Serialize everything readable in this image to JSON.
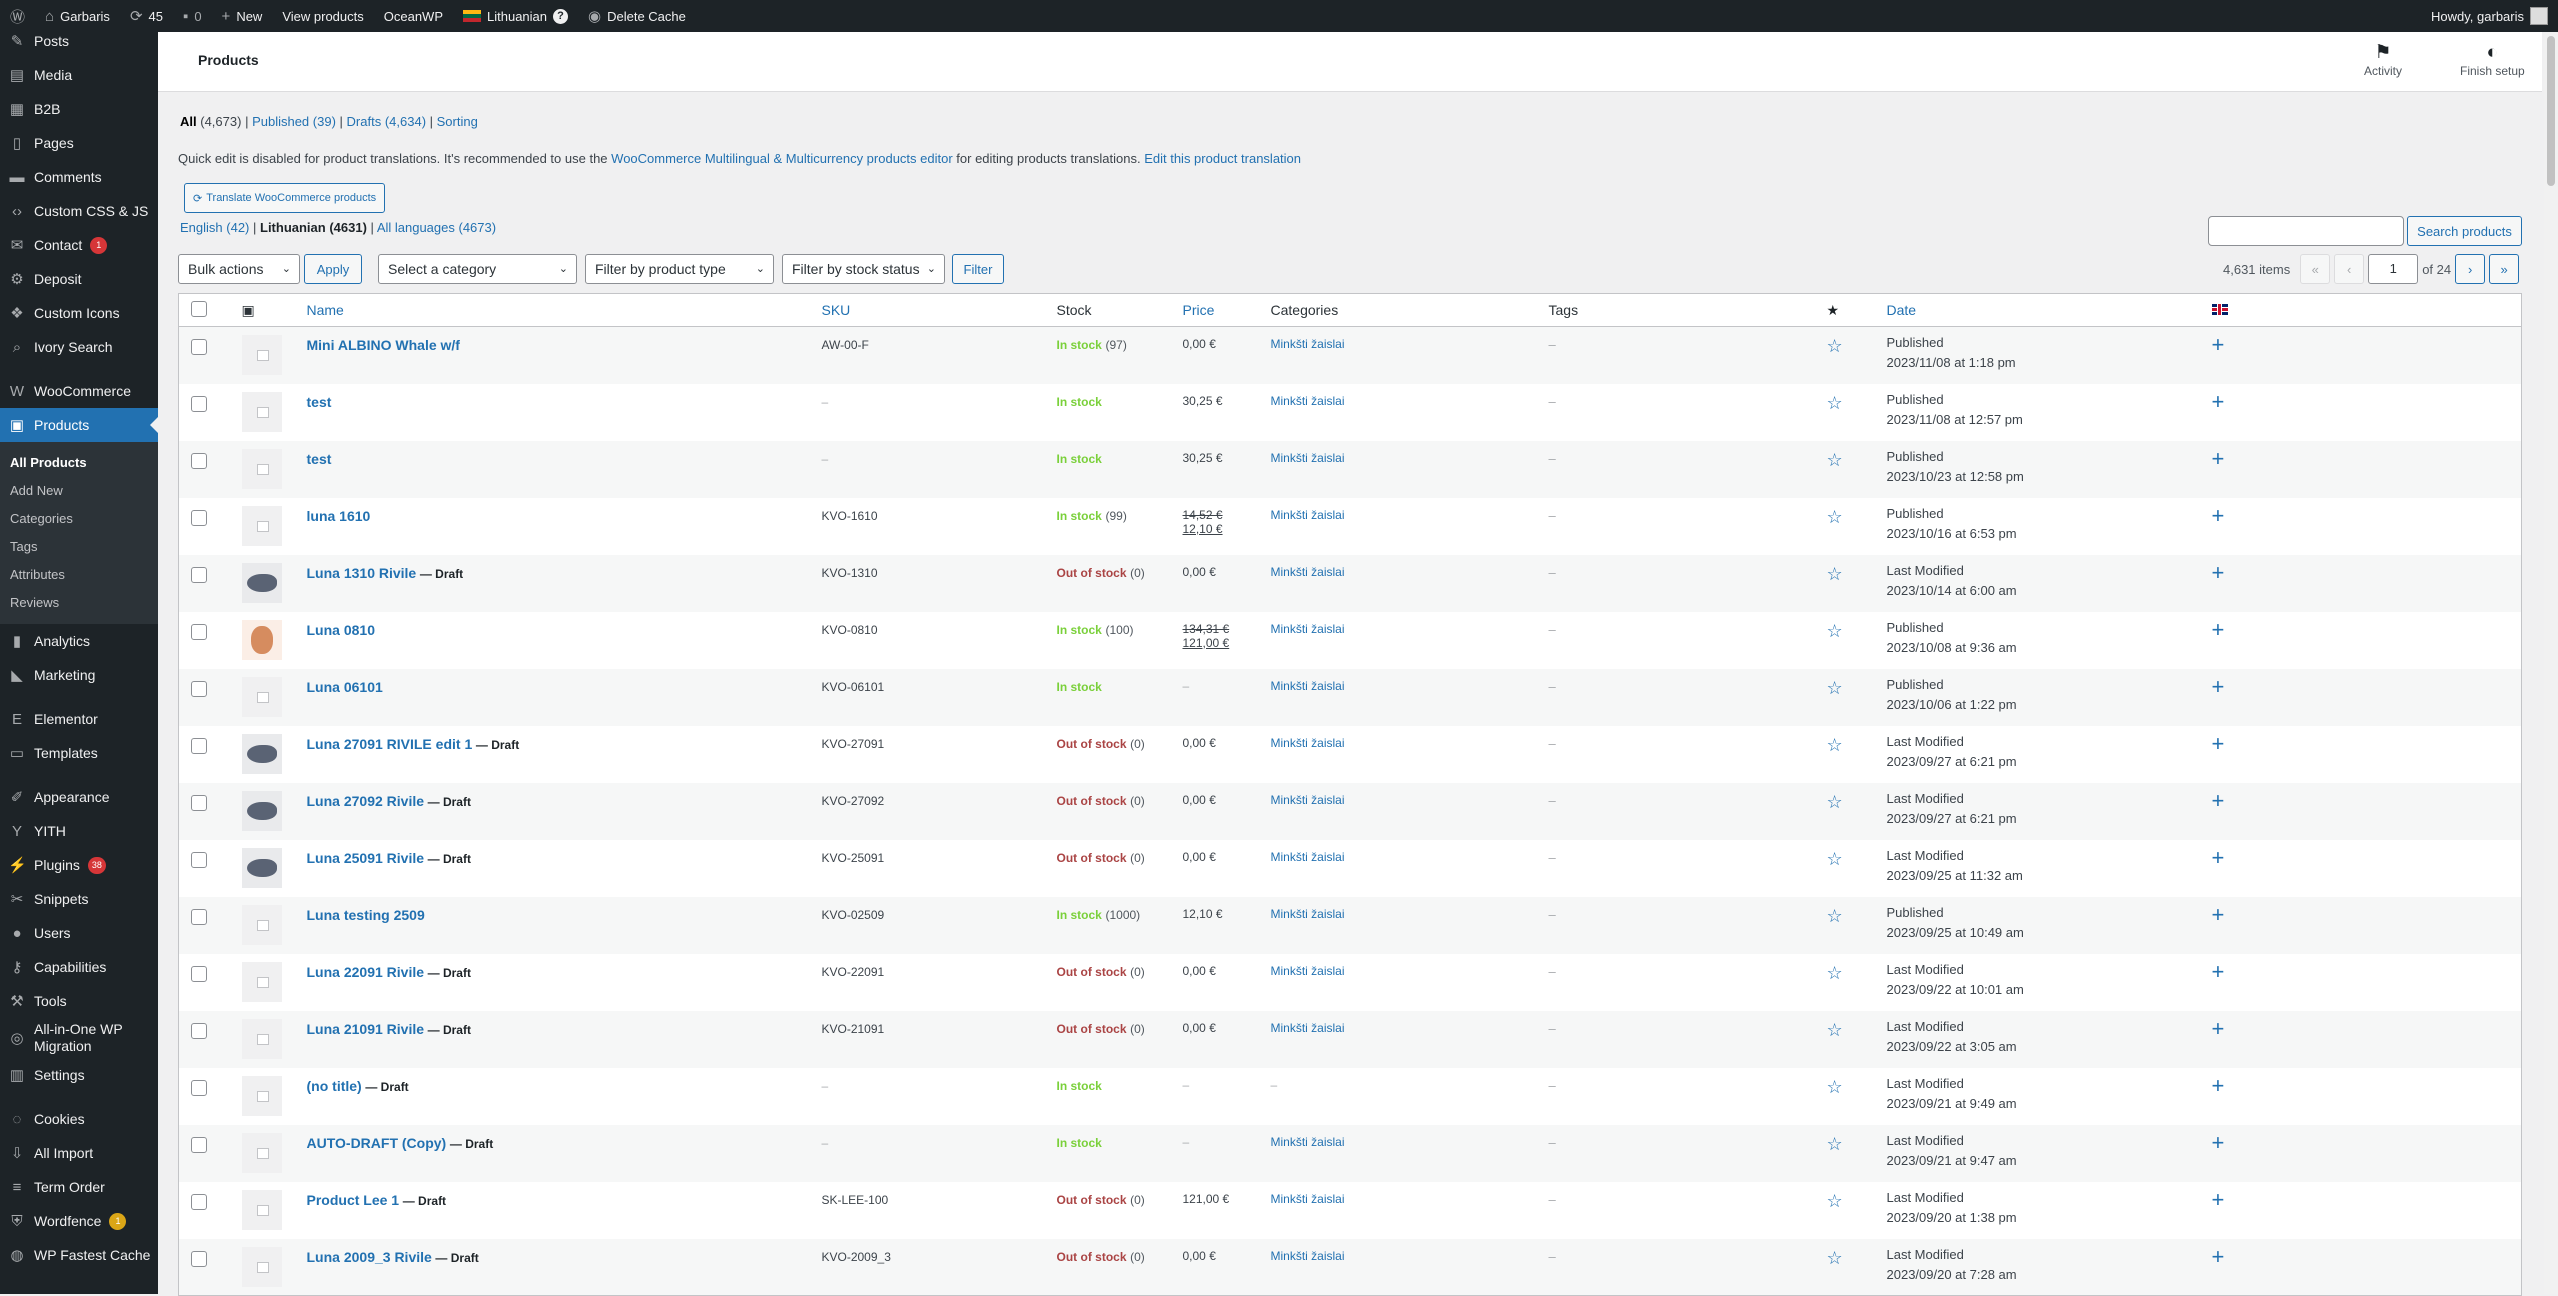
{
  "adminbar": {
    "site_name": "Garbaris",
    "updates": "45",
    "comments": "0",
    "new_label": "New",
    "view_products": "View products",
    "theme": "OceanWP",
    "language": "Lithuanian",
    "language_help": "?",
    "delete_cache": "Delete Cache",
    "howdy": "Howdy, garbaris"
  },
  "sidebar": {
    "items": [
      {
        "label": "Posts",
        "icon": "pin-icon"
      },
      {
        "label": "Media",
        "icon": "media-icon"
      },
      {
        "label": "B2B",
        "icon": "b2b-icon"
      },
      {
        "label": "Pages",
        "icon": "page-icon"
      },
      {
        "label": "Comments",
        "icon": "comment-icon"
      },
      {
        "label": "Custom CSS & JS",
        "icon": "code-icon"
      },
      {
        "label": "Contact",
        "icon": "mail-icon",
        "badge": "1"
      },
      {
        "label": "Deposit",
        "icon": "gear-icon"
      },
      {
        "label": "Custom Icons",
        "icon": "icons-icon"
      },
      {
        "label": "Ivory Search",
        "icon": "search-icon"
      },
      {
        "label": "WooCommerce",
        "icon": "woo-icon"
      },
      {
        "label": "Products",
        "icon": "box-icon"
      },
      {
        "label": "Analytics",
        "icon": "chart-icon"
      },
      {
        "label": "Marketing",
        "icon": "megaphone-icon"
      },
      {
        "label": "Elementor",
        "icon": "elementor-icon"
      },
      {
        "label": "Templates",
        "icon": "folder-icon"
      },
      {
        "label": "Appearance",
        "icon": "brush-icon"
      },
      {
        "label": "YITH",
        "icon": "yith-icon"
      },
      {
        "label": "Plugins",
        "icon": "plug-icon",
        "badge": "38"
      },
      {
        "label": "Snippets",
        "icon": "scissors-icon"
      },
      {
        "label": "Users",
        "icon": "user-icon"
      },
      {
        "label": "Capabilities",
        "icon": "key-icon"
      },
      {
        "label": "Tools",
        "icon": "wrench-icon"
      },
      {
        "label": "All-in-One WP Migration",
        "icon": "migration-icon"
      },
      {
        "label": "Settings",
        "icon": "settings-icon"
      },
      {
        "label": "Cookies",
        "icon": "cookie-icon"
      },
      {
        "label": "All Import",
        "icon": "import-icon"
      },
      {
        "label": "Term Order",
        "icon": "list-icon"
      },
      {
        "label": "Wordfence",
        "icon": "shield-icon",
        "badge": "1"
      },
      {
        "label": "WP Fastest Cache",
        "icon": "cache-icon"
      }
    ],
    "products_sub": [
      "All Products",
      "Add New",
      "Categories",
      "Tags",
      "Attributes",
      "Reviews"
    ]
  },
  "header": {
    "title": "Products",
    "activity": "Activity",
    "finish_setup": "Finish setup"
  },
  "views": {
    "all": "All",
    "all_count": "(4,673)",
    "published": "Published",
    "published_count": "(39)",
    "drafts": "Drafts",
    "drafts_count": "(4,634)",
    "sorting": "Sorting"
  },
  "notice": {
    "text1": "Quick edit is disabled for product translations. It's recommended to use the",
    "link1": "WooCommerce Multilingual & Multicurrency products editor",
    "text2": "for editing products translations.",
    "link2": "Edit this product translation"
  },
  "translate_button": "Translate WooCommerce products",
  "languages": {
    "english": "English",
    "english_count": "(42)",
    "lithuanian": "Lithuanian",
    "lithuanian_count": "(4631)",
    "all": "All languages",
    "all_count": "(4673)"
  },
  "search": {
    "button": "Search products",
    "value": ""
  },
  "filters": {
    "bulk_actions": "Bulk actions",
    "apply": "Apply",
    "category": "Select a category",
    "product_type": "Filter by product type",
    "stock_status": "Filter by stock status",
    "filter": "Filter"
  },
  "pagination": {
    "items": "4,631 items",
    "first": "«",
    "prev": "‹",
    "current": "1",
    "of": "of 24",
    "next": "›",
    "last": "»"
  },
  "columns": {
    "name": "Name",
    "sku": "SKU",
    "stock": "Stock",
    "price": "Price",
    "categories": "Categories",
    "tags": "Tags",
    "featured": "★",
    "date": "Date"
  },
  "rows": [
    {
      "name": "Mini ALBINO Whale w/f",
      "draft": "",
      "sku": "AW-00-F",
      "stock": "In stock",
      "stock_count": "(97)",
      "price": "0,00 €",
      "price_old": "",
      "category": "Minkšti žaislai",
      "tags": "–",
      "date_status": "Published",
      "date": "2023/11/08 at 1:18 pm",
      "thumb": "placeholder"
    },
    {
      "name": "test",
      "draft": "",
      "sku": "–",
      "stock": "In stock",
      "stock_count": "",
      "price": "30,25 €",
      "price_old": "",
      "category": "Minkšti žaislai",
      "tags": "–",
      "date_status": "Published",
      "date": "2023/11/08 at 12:57 pm",
      "thumb": "placeholder"
    },
    {
      "name": "test",
      "draft": "",
      "sku": "–",
      "stock": "In stock",
      "stock_count": "",
      "price": "30,25 €",
      "price_old": "",
      "category": "Minkšti žaislai",
      "tags": "–",
      "date_status": "Published",
      "date": "2023/10/23 at 12:58 pm",
      "thumb": "placeholder"
    },
    {
      "name": "luna 1610",
      "draft": "",
      "sku": "KVO-1610",
      "stock": "In stock",
      "stock_count": "(99)",
      "price": "12,10 €",
      "price_old": "14,52 €",
      "category": "Minkšti žaislai",
      "tags": "–",
      "date_status": "Published",
      "date": "2023/10/16 at 6:53 pm",
      "thumb": "placeholder"
    },
    {
      "name": "Luna 1310 Rivile",
      "draft": "— Draft",
      "sku": "KVO-1310",
      "stock": "Out of stock",
      "stock_count": "(0)",
      "price": "0,00 €",
      "price_old": "",
      "category": "Minkšti žaislai",
      "tags": "–",
      "date_status": "Last Modified",
      "date": "2023/10/14 at 6:00 am",
      "thumb": "shark"
    },
    {
      "name": "Luna 0810",
      "draft": "",
      "sku": "KVO-0810",
      "stock": "In stock",
      "stock_count": "(100)",
      "price": "121,00 €",
      "price_old": "134,31 €",
      "category": "Minkšti žaislai",
      "tags": "–",
      "date_status": "Published",
      "date": "2023/10/08 at 9:36 am",
      "thumb": "bear"
    },
    {
      "name": "Luna 06101",
      "draft": "",
      "sku": "KVO-06101",
      "stock": "In stock",
      "stock_count": "",
      "price": "–",
      "price_old": "",
      "category": "Minkšti žaislai",
      "tags": "–",
      "date_status": "Published",
      "date": "2023/10/06 at 1:22 pm",
      "thumb": "placeholder"
    },
    {
      "name": "Luna 27091 RIVILE edit 1",
      "draft": "— Draft",
      "sku": "KVO-27091",
      "stock": "Out of stock",
      "stock_count": "(0)",
      "price": "0,00 €",
      "price_old": "",
      "category": "Minkšti žaislai",
      "tags": "–",
      "date_status": "Last Modified",
      "date": "2023/09/27 at 6:21 pm",
      "thumb": "shark"
    },
    {
      "name": "Luna 27092 Rivile",
      "draft": "— Draft",
      "sku": "KVO-27092",
      "stock": "Out of stock",
      "stock_count": "(0)",
      "price": "0,00 €",
      "price_old": "",
      "category": "Minkšti žaislai",
      "tags": "–",
      "date_status": "Last Modified",
      "date": "2023/09/27 at 6:21 pm",
      "thumb": "shark"
    },
    {
      "name": "Luna 25091 Rivile",
      "draft": "— Draft",
      "sku": "KVO-25091",
      "stock": "Out of stock",
      "stock_count": "(0)",
      "price": "0,00 €",
      "price_old": "",
      "category": "Minkšti žaislai",
      "tags": "–",
      "date_status": "Last Modified",
      "date": "2023/09/25 at 11:32 am",
      "thumb": "shark"
    },
    {
      "name": "Luna testing 2509",
      "draft": "",
      "sku": "KVO-02509",
      "stock": "In stock",
      "stock_count": "(1000)",
      "price": "12,10 €",
      "price_old": "",
      "category": "Minkšti žaislai",
      "tags": "–",
      "date_status": "Published",
      "date": "2023/09/25 at 10:49 am",
      "thumb": "placeholder"
    },
    {
      "name": "Luna 22091 Rivile",
      "draft": "— Draft",
      "sku": "KVO-22091",
      "stock": "Out of stock",
      "stock_count": "(0)",
      "price": "0,00 €",
      "price_old": "",
      "category": "Minkšti žaislai",
      "tags": "–",
      "date_status": "Last Modified",
      "date": "2023/09/22 at 10:01 am",
      "thumb": "placeholder"
    },
    {
      "name": "Luna 21091 Rivile",
      "draft": "— Draft",
      "sku": "KVO-21091",
      "stock": "Out of stock",
      "stock_count": "(0)",
      "price": "0,00 €",
      "price_old": "",
      "category": "Minkšti žaislai",
      "tags": "–",
      "date_status": "Last Modified",
      "date": "2023/09/22 at 3:05 am",
      "thumb": "placeholder"
    },
    {
      "name": "(no title)",
      "draft": "— Draft",
      "sku": "–",
      "stock": "In stock",
      "stock_count": "",
      "price": "–",
      "price_old": "",
      "category": "–",
      "tags": "–",
      "date_status": "Last Modified",
      "date": "2023/09/21 at 9:49 am",
      "thumb": "placeholder"
    },
    {
      "name": "AUTO-DRAFT (Copy)",
      "draft": "— Draft",
      "sku": "–",
      "stock": "In stock",
      "stock_count": "",
      "price": "–",
      "price_old": "",
      "category": "Minkšti žaislai",
      "tags": "–",
      "date_status": "Last Modified",
      "date": "2023/09/21 at 9:47 am",
      "thumb": "placeholder"
    },
    {
      "name": "Product Lee 1",
      "draft": "— Draft",
      "sku": "SK-LEE-100",
      "stock": "Out of stock",
      "stock_count": "(0)",
      "price": "121,00 €",
      "price_old": "",
      "category": "Minkšti žaislai",
      "tags": "–",
      "date_status": "Last Modified",
      "date": "2023/09/20 at 1:38 pm",
      "thumb": "placeholder"
    },
    {
      "name": "Luna 2009_3 Rivile",
      "draft": "— Draft",
      "sku": "KVO-2009_3",
      "stock": "Out of stock",
      "stock_count": "(0)",
      "price": "0,00 €",
      "price_old": "",
      "category": "Minkšti žaislai",
      "tags": "–",
      "date_status": "Last Modified",
      "date": "2023/09/20 at 7:28 am",
      "thumb": "placeholder"
    }
  ],
  "colors": {
    "accent": "#2271b1",
    "adminbar": "#1d2327",
    "in_stock": "#7ad03a",
    "out_of_stock": "#a44"
  }
}
